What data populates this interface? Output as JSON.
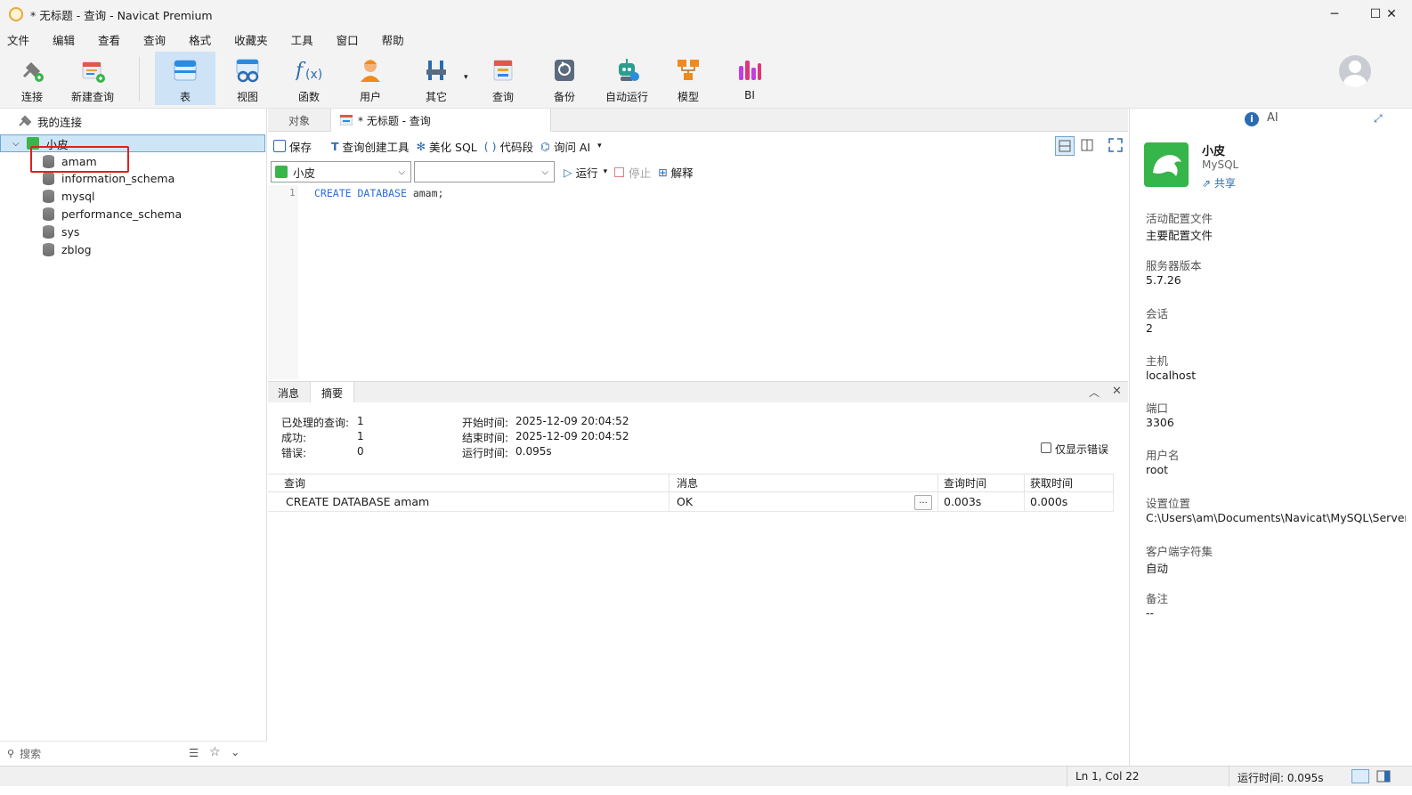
{
  "window": {
    "title": "* 无标题 - 查询 - Navicat Premium",
    "minimize": "─",
    "maximize": "☐",
    "close": "✕"
  },
  "menu": [
    "文件",
    "编辑",
    "查看",
    "查询",
    "格式",
    "收藏夹",
    "工具",
    "窗口",
    "帮助"
  ],
  "toolbar": {
    "connect": "连接",
    "new_query": "新建查询",
    "table": "表",
    "view": "视图",
    "function": "函数",
    "user": "用户",
    "other": "其它",
    "query": "查询",
    "backup": "备份",
    "automation": "自动运行",
    "model": "模型",
    "bi": "BI"
  },
  "navigator": {
    "root": "我的连接",
    "connection": "小皮",
    "databases": [
      "amam",
      "information_schema",
      "mysql",
      "performance_schema",
      "sys",
      "zblog"
    ],
    "search_placeholder": "搜索"
  },
  "tabs": {
    "objects": "对象",
    "query_tab": "* 无标题 - 查询"
  },
  "query_toolbar": {
    "save": "保存",
    "builder": "查询创建工具",
    "beautify": "美化 SQL",
    "snippet": "代码段",
    "ask_ai": "询问 AI",
    "run": "运行",
    "stop": "停止",
    "explain": "解释"
  },
  "selectors": {
    "connection": "小皮",
    "database": ""
  },
  "editor": {
    "line": "1",
    "kw1": "CREATE",
    "kw2": "DATABASE",
    "ident": "amam;"
  },
  "results": {
    "tabs": [
      "消息",
      "摘要"
    ],
    "summary": {
      "processed_label": "已处理的查询:",
      "processed": "1",
      "success_label": "成功:",
      "success": "1",
      "error_label": "错误:",
      "error": "0",
      "start_label": "开始时间:",
      "start": "2025-12-09 20:04:52",
      "end_label": "结束时间:",
      "end": "2025-12-09 20:04:52",
      "runtime_label": "运行时间:",
      "runtime": "0.095s",
      "only_errors": "仅显示错误"
    },
    "columns": [
      "查询",
      "消息",
      "查询时间",
      "获取时间"
    ],
    "rows": [
      {
        "query": "CREATE DATABASE amam",
        "message": "OK",
        "more": "...",
        "query_time": "0.003s",
        "fetch_time": "0.000s"
      }
    ]
  },
  "info_panel": {
    "ai_label": "AI",
    "name": "小皮",
    "type": "MySQL",
    "share": "共享",
    "fields": [
      {
        "label": "活动配置文件",
        "value": "主要配置文件"
      },
      {
        "label": "服务器版本",
        "value": "5.7.26"
      },
      {
        "label": "会话",
        "value": "2"
      },
      {
        "label": "主机",
        "value": "localhost"
      },
      {
        "label": "端口",
        "value": "3306"
      },
      {
        "label": "用户名",
        "value": "root"
      },
      {
        "label": "设置位置",
        "value": "C:\\Users\\am\\Documents\\Navicat\\MySQL\\Server"
      },
      {
        "label": "客户端字符集",
        "value": "自动"
      },
      {
        "label": "备注",
        "value": "--"
      }
    ]
  },
  "status": {
    "position": "Ln 1, Col 22",
    "runtime": "运行时间: 0.095s"
  },
  "colors": {
    "accent": "#2b6cb0",
    "selection": "#cde6f7",
    "mysql_green": "#36b54a",
    "highlight_red": "#e02020"
  }
}
